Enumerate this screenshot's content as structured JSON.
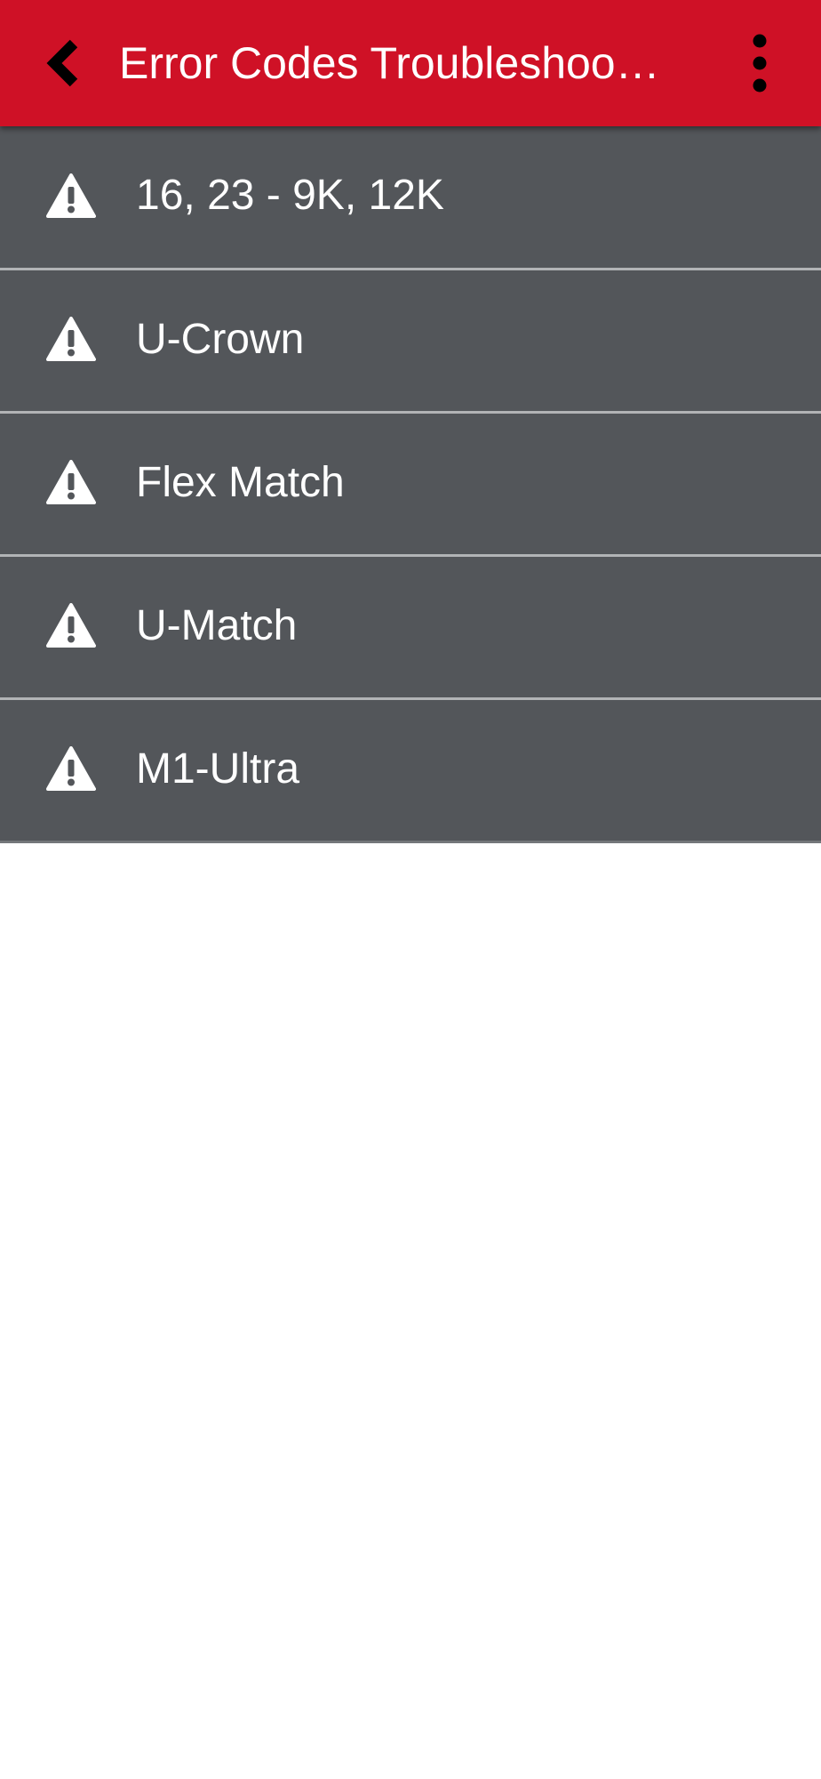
{
  "app_bar": {
    "title": "Error Codes Troubleshoo…",
    "back_icon": "chevron-left-icon",
    "menu_icon": "more-vertical-icon"
  },
  "list": {
    "item_icon": "warning-triangle-icon",
    "items": [
      {
        "label": "16, 23 - 9K, 12K"
      },
      {
        "label": "U-Crown"
      },
      {
        "label": "Flex Match"
      },
      {
        "label": "U-Match"
      },
      {
        "label": "M1-Ultra"
      }
    ]
  },
  "colors": {
    "app_bar_background": "#cf1126",
    "app_bar_text": "#ffffff",
    "back_icon": "#000000",
    "list_background": "#53565a",
    "list_text": "#ffffff",
    "divider": "#b2b4b6",
    "page_background": "#ffffff"
  }
}
